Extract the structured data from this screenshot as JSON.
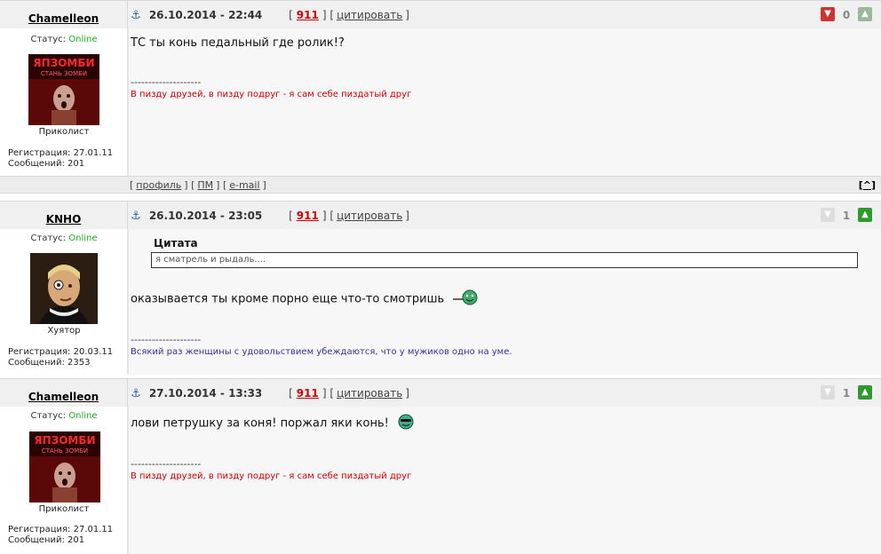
{
  "posts": [
    {
      "nick": "Chamelleon",
      "date": "26.10.2014 - 22:44",
      "post_number": "911",
      "quote_label": "цитировать",
      "rating": "0",
      "status_label": "Статус:",
      "status_value": "Online",
      "rank": "Приколист",
      "registration": "Регистрация: 27.01.11",
      "messages": "Сообщений: 201",
      "message": "ТС ты конь педальный где ролик!?",
      "sig_divider": "--------------------",
      "signature": "В пизду друзей, в пизду подруг - я сам себе пиздатый друг",
      "footer": {
        "profile": "профиль",
        "pm": "ПМ",
        "email": "e-mail",
        "up": "^"
      }
    },
    {
      "nick": "KNHO",
      "date": "26.10.2014 - 23:05",
      "post_number": "911",
      "quote_label": "цитировать",
      "rating": "1",
      "status_label": "Статус:",
      "status_value": "Online",
      "rank": "Хуятор",
      "registration": "Регистрация: 20.03.11",
      "messages": "Сообщений: 2353",
      "quote_title": "Цитата",
      "quote_text": "я сматрель и рыдаль....",
      "message": "оказывается ты кроме порно еще что-то смотришь",
      "sig_divider": "--------------------",
      "signature": "Всякий раз женщины с удовольствием убеждаются, что у мужиков одно на уме."
    },
    {
      "nick": "Chamelleon",
      "date": "27.10.2014 - 13:33",
      "post_number": "911",
      "quote_label": "цитировать",
      "rating": "1",
      "status_label": "Статус:",
      "status_value": "Online",
      "rank": "Приколист",
      "registration": "Регистрация: 27.01.11",
      "messages": "Сообщений: 201",
      "message": "лови петрушку за коня! поржал яки конь!",
      "sig_divider": "--------------------",
      "signature": "В пизду друзей, в пизду подруг - я сам себе пиздатый друг"
    }
  ],
  "colors": {
    "post_number": "#cc0000",
    "online": "#22aa22",
    "signature_red": "#cc0000",
    "signature_blue": "#333399",
    "rate_plus": "#2e9a2e",
    "rate_minus": "#cc3333"
  },
  "icons": [
    "anchor-icon",
    "thumbs-down-icon",
    "thumbs-up-icon",
    "zombie-avatar",
    "portrait-avatar",
    "smiley-icon"
  ]
}
